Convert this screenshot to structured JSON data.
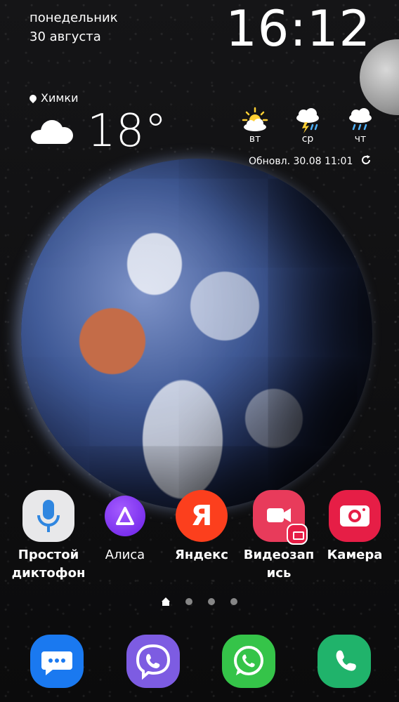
{
  "status": {
    "weekday": "понедельник",
    "date": "30 августа",
    "time": "16:12"
  },
  "weather": {
    "location": "Химки",
    "temperature": "18°",
    "current_icon": "cloud-icon",
    "forecast": [
      {
        "day": "вт",
        "icon": "sun-cloud-icon"
      },
      {
        "day": "ср",
        "icon": "thunderstorm-icon"
      },
      {
        "day": "чт",
        "icon": "rain-icon"
      }
    ],
    "updated": "Обновл. 30.08 11:01"
  },
  "apps": [
    {
      "label": "Простой диктофон",
      "icon": "microphone-icon",
      "color": "#e8e8ea"
    },
    {
      "label": "Алиса",
      "icon": "alice-icon",
      "color": "#7b2bf0"
    },
    {
      "label": "Яндекс",
      "icon": "yandex-icon",
      "color": "#fc3f1d"
    },
    {
      "label": "Видеозапись",
      "icon": "video-icon",
      "color": "#e83b5b"
    },
    {
      "label": "Камера",
      "icon": "camera-icon",
      "color": "#e61e46"
    }
  ],
  "yandex_letter": "Я",
  "dock": [
    {
      "name": "messages",
      "icon": "chat-icon",
      "color": "#1a79f0"
    },
    {
      "name": "viber",
      "icon": "viber-icon",
      "color": "#7d5ce2"
    },
    {
      "name": "whatsapp",
      "icon": "whatsapp-icon",
      "color": "#35c449"
    },
    {
      "name": "phone",
      "icon": "phone-icon",
      "color": "#20b36b"
    }
  ],
  "pages": {
    "count": 4,
    "current": 1
  }
}
